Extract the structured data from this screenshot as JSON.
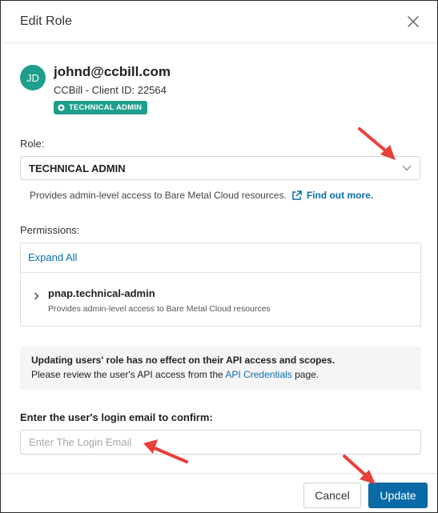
{
  "modal": {
    "title": "Edit Role",
    "close_icon": "close-icon"
  },
  "user": {
    "initials": "JD",
    "email": "johnd@ccbill.com",
    "client": "CCBill - Client ID: 22564",
    "badge": "TECHNICAL ADMIN"
  },
  "role": {
    "label": "Role:",
    "selected": "TECHNICAL ADMIN",
    "description": "Provides admin-level access to Bare Metal Cloud resources.",
    "link": "Find out more."
  },
  "permissions": {
    "label": "Permissions:",
    "expand_all": "Expand All",
    "items": [
      {
        "name": "pnap.technical-admin",
        "description": "Provides admin-level access to Bare Metal Cloud resources"
      }
    ]
  },
  "notice": {
    "title": "Updating users' role has no effect on their API access and scopes.",
    "body_prefix": "Please review the user's API access from the",
    "link": "API Credentials",
    "body_suffix": "page."
  },
  "confirm": {
    "label": "Enter the user's login email to confirm:",
    "placeholder": "Enter The Login Email",
    "value": ""
  },
  "footer": {
    "cancel_label": "Cancel",
    "update_label": "Update"
  },
  "colors": {
    "accent_teal": "#1e9e8c",
    "primary_blue": "#0a6aa8",
    "link_blue": "#0a6fb0",
    "annotation_red": "#e8403a"
  }
}
